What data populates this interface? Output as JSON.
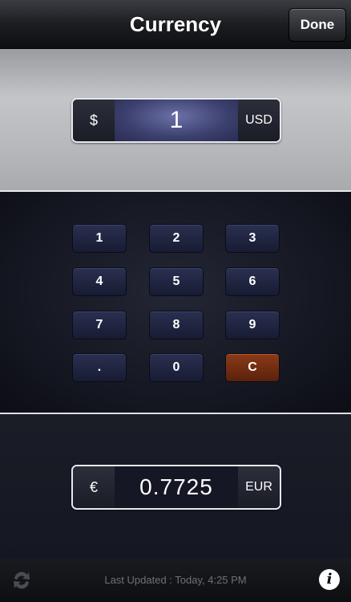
{
  "header": {
    "title": "Currency",
    "done_label": "Done"
  },
  "from": {
    "symbol": "$",
    "value": "1",
    "code": "USD"
  },
  "keypad": {
    "keys": [
      "1",
      "2",
      "3",
      "4",
      "5",
      "6",
      "7",
      "8",
      "9",
      ".",
      "0",
      "C"
    ]
  },
  "to": {
    "symbol": "€",
    "value": "0.7725",
    "code": "EUR"
  },
  "toolbar": {
    "status": "Last Updated : Today, 4:25 PM",
    "info_glyph": "i"
  },
  "colors": {
    "clear_key": "#7a3414",
    "key": "#1f2440",
    "panel_light": "#b9babe"
  }
}
